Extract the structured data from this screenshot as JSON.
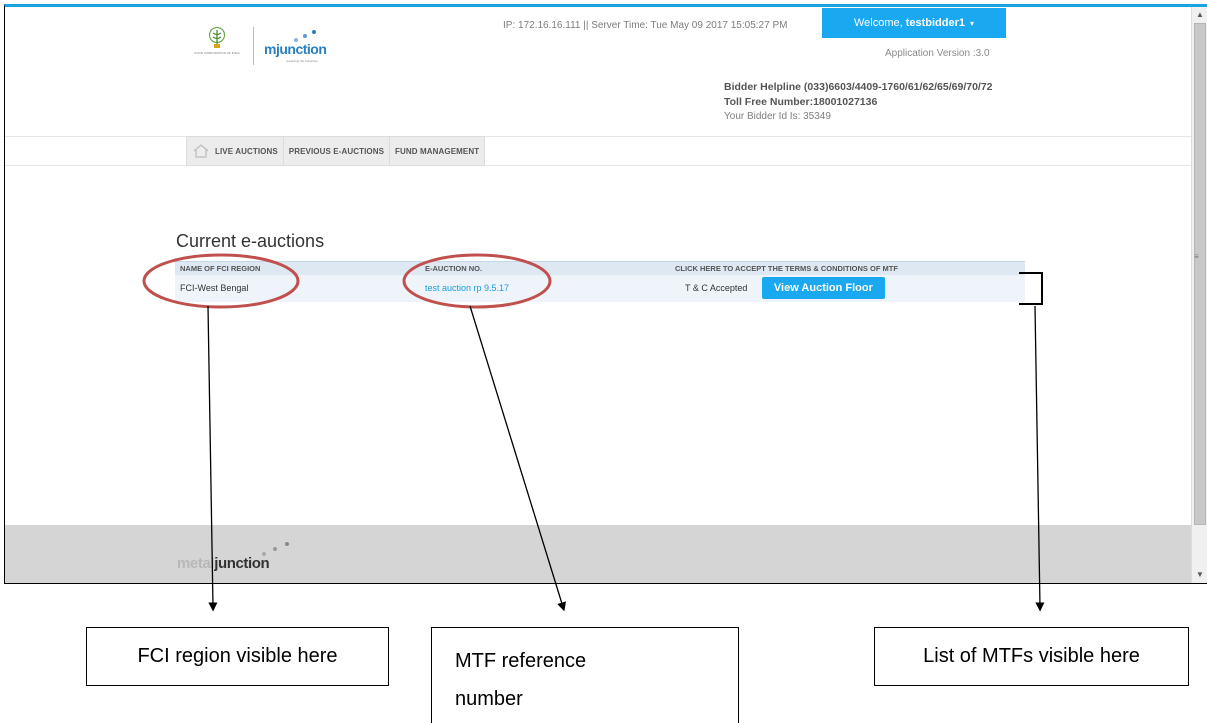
{
  "header": {
    "fci_logo_text": "FOOD CORPORATION OF INDIA",
    "mjunction_logo": "mjunction",
    "mjunction_tagline": "rewarding the industries",
    "server_info": "IP: 172.16.16.111 || Server Time: Tue May 09 2017 15:05:27 PM",
    "welcome_prefix": "Welcome,",
    "username": "testbidder1",
    "app_version": "Application Version :3.0",
    "helpline": "Bidder Helpline (033)6603/4409-1760/61/62/65/69/70/72",
    "tollfree": "Toll Free Number:18001027136",
    "bidder_id": "Your Bidder Id Is: 35349"
  },
  "nav": {
    "items": [
      {
        "label": "LIVE AUCTIONS"
      },
      {
        "label": "PREVIOUS E-AUCTIONS"
      },
      {
        "label": "FUND MANAGEMENT"
      }
    ]
  },
  "main": {
    "title": "Current e-auctions",
    "table": {
      "headers": [
        "NAME OF FCI REGION",
        "E-AUCTION NO.",
        "CLICK HERE TO ACCEPT THE TERMS & CONDITIONS OF MTF"
      ],
      "rows": [
        {
          "region": "FCI-West Bengal",
          "auction_no": "test auction rp 9.5.17",
          "tc_status": "T & C Accepted",
          "action": "View Auction Floor"
        }
      ]
    }
  },
  "footer": {
    "logo_part1": "metal",
    "logo_part2": "junction"
  },
  "annotations": {
    "fci_region": "FCI region visible here",
    "mtf_ref_line1": "MTF reference",
    "mtf_ref_line2": "number",
    "mtf_list": "List of MTFs visible here"
  },
  "colors": {
    "accent": "#1aa8f0",
    "link": "#1a9be0",
    "table_header": "#dde8f3",
    "table_row": "#eef4fa",
    "annotation_circle": "#c0504d"
  }
}
